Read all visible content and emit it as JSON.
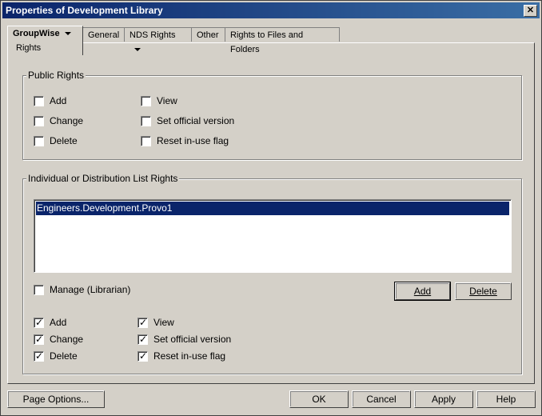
{
  "window": {
    "title": "Properties of Development Library"
  },
  "tabs": [
    {
      "label": "GroupWise",
      "sub": "Rights"
    },
    {
      "label": "General"
    },
    {
      "label": "NDS Rights"
    },
    {
      "label": "Other"
    },
    {
      "label": "Rights to Files and Folders"
    }
  ],
  "public_rights": {
    "legend": "Public Rights",
    "checkboxes": [
      {
        "label": "Add",
        "checked": false
      },
      {
        "label": "Change",
        "checked": false
      },
      {
        "label": "Delete",
        "checked": false
      },
      {
        "label": "View",
        "checked": false
      },
      {
        "label": "Set official version",
        "checked": false
      },
      {
        "label": "Reset in-use flag",
        "checked": false
      }
    ]
  },
  "individual_rights": {
    "legend": "Individual or Distribution List Rights",
    "list_items": [
      "Engineers.Development.Provo1"
    ],
    "manage_label": "Manage (Librarian)",
    "add_button": "Add",
    "delete_button": "Delete",
    "checkboxes": [
      {
        "label": "Add",
        "checked": true
      },
      {
        "label": "Change",
        "checked": true
      },
      {
        "label": "Delete",
        "checked": true
      },
      {
        "label": "View",
        "checked": true
      },
      {
        "label": "Set official version",
        "checked": true
      },
      {
        "label": "Reset in-use flag",
        "checked": true
      }
    ]
  },
  "footer": {
    "page_options": "Page Options...",
    "ok": "OK",
    "cancel": "Cancel",
    "apply": "Apply",
    "help": "Help"
  }
}
